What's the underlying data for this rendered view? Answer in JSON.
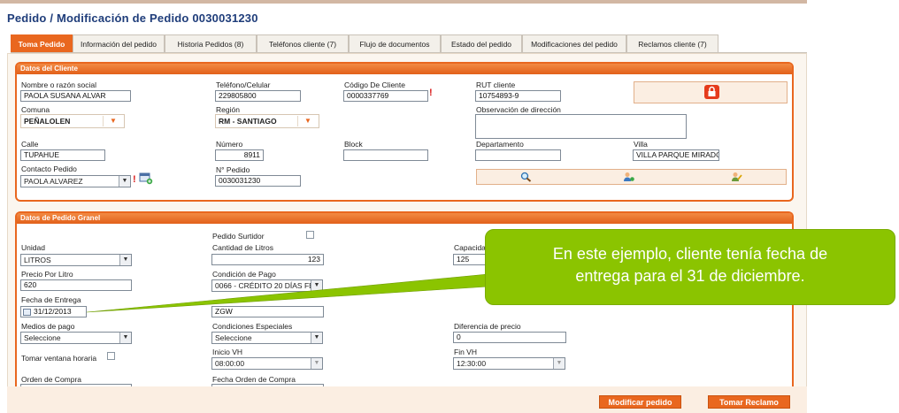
{
  "page": {
    "title": "Pedido / Modificación de Pedido 0030031230"
  },
  "tabs": [
    {
      "label": "Toma Pedido",
      "active": true
    },
    {
      "label": "Información del pedido"
    },
    {
      "label": "Historia Pedidos (8)"
    },
    {
      "label": "Teléfonos cliente (7)"
    },
    {
      "label": "Flujo de documentos"
    },
    {
      "label": "Estado del pedido"
    },
    {
      "label": "Modificaciones del pedido"
    },
    {
      "label": "Reclamos cliente (7)"
    }
  ],
  "cliente": {
    "header": "Datos del Cliente",
    "nombre": {
      "label": "Nombre o razón social",
      "value": "PAOLA SUSANA ALVAR"
    },
    "telefono": {
      "label": "Teléfono/Celular",
      "value": "229805800"
    },
    "codigo": {
      "label": "Código De Cliente",
      "value": "0000337769"
    },
    "rut": {
      "label": "RUT cliente",
      "value": "10754893-9"
    },
    "comuna": {
      "label": "Comuna",
      "value": "PEÑALOLEN"
    },
    "region": {
      "label": "Región",
      "value": "RM - SANTIAGO"
    },
    "observacion": {
      "label": "Observación de dirección",
      "value": ""
    },
    "calle": {
      "label": "Calle",
      "value": "TUPAHUE"
    },
    "numero": {
      "label": "Número",
      "value": "8911"
    },
    "block": {
      "label": "Block",
      "value": ""
    },
    "departamento": {
      "label": "Departamento",
      "value": ""
    },
    "villa": {
      "label": "Villa",
      "value": "VILLA PARQUE MIRADO"
    },
    "contacto": {
      "label": "Contacto Pedido",
      "value": "PAOLA ALVAREZ"
    },
    "npedido": {
      "label": "N° Pedido",
      "value": "0030031230"
    }
  },
  "granel": {
    "header": "Datos de Pedido Granel",
    "surtidor": {
      "label": "Pedido Surtidor"
    },
    "unidad": {
      "label": "Unidad",
      "value": "LITROS"
    },
    "cantidad": {
      "label": "Cantidad de Litros",
      "value": "123"
    },
    "capacidad": {
      "label": "Capacida",
      "value": "125"
    },
    "precio": {
      "label": "Precio Por Litro",
      "value": "620"
    },
    "condicion": {
      "label": "Condición de Pago",
      "value": "0066 - CRÉDITO 20 DÍAS FE"
    },
    "fecha": {
      "label": "Fecha de Entrega",
      "value": "31/12/2013"
    },
    "codigo2": {
      "value": "ZGW"
    },
    "medios": {
      "label": "Medios de pago",
      "value": "Seleccione"
    },
    "condiciones": {
      "label": "Condiciones Especiales",
      "value": "Seleccione"
    },
    "diferencia": {
      "label": "Diferencia de precio",
      "value": "0"
    },
    "ventana": {
      "label": "Tomar ventana horaria"
    },
    "inicio": {
      "label": "Inicio VH",
      "value": "08:00:00"
    },
    "fin": {
      "label": "Fin VH",
      "value": "12:30:00"
    },
    "orden": {
      "label": "Orden de Compra"
    },
    "fecha_orden": {
      "label": "Fecha Orden de Compra"
    }
  },
  "callout": {
    "line1": "En este ejemplo, cliente tenía fecha de",
    "line2": "entrega para el 31 de diciembre."
  },
  "footer": {
    "modificar": "Modificar pedido",
    "reclamo": "Tomar Reclamo"
  },
  "colors": {
    "accent": "#e9671f",
    "callout": "#8bc400",
    "title": "#1f3d7a"
  }
}
